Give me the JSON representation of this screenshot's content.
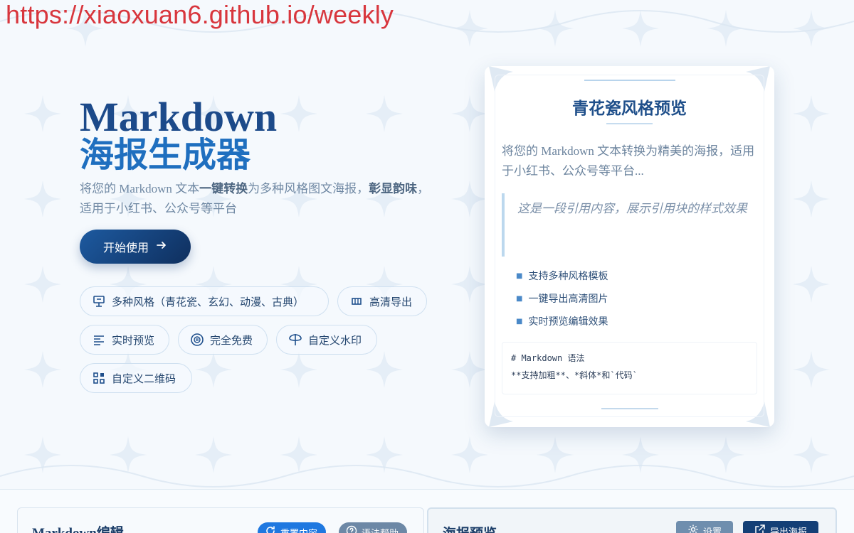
{
  "banner": {
    "url": "https://xiaoxuan6.github.io/weekly"
  },
  "hero": {
    "title_en": "Markdown",
    "title_cn": "海报生成器",
    "desc_part1": "将您的 Markdown 文本",
    "desc_bold1": "一键转换",
    "desc_part2": "为多种风格图文海报，",
    "desc_bold2": "彰显韵味",
    "desc_part3": "，",
    "desc_line2": "适用于小红书、公众号等平台",
    "start_button": "开始使用"
  },
  "features": [
    {
      "label": "多种风格（青花瓷、玄幻、动漫、古典）",
      "icon": "presentation-icon"
    },
    {
      "label": "高清导出",
      "icon": "film-icon"
    },
    {
      "label": "实时预览",
      "icon": "align-left-icon"
    },
    {
      "label": "完全免费",
      "icon": "coin-icon"
    },
    {
      "label": "自定义水印",
      "icon": "signpost-icon"
    },
    {
      "label": "自定义二维码",
      "icon": "qrcode-icon"
    }
  ],
  "preview_card": {
    "title": "青花瓷风格预览",
    "paragraph": "将您的 Markdown 文本转换为精美的海报，适用于小红书、公众号等平台...",
    "quote": "这是一段引用内容，展示引用块的样式效果",
    "list": [
      "支持多种风格模板",
      "一键导出高清图片",
      "实时预览编辑效果"
    ],
    "code_line1": "# Markdown 语法",
    "code_line2": "**支持加粗**、*斜体*和`代码`"
  },
  "editor_panel": {
    "title": "Markdown编辑",
    "reset_button": "重置内容",
    "help_button": "语法帮助"
  },
  "poster_panel": {
    "title": "海报预览",
    "settings_button": "设置",
    "export_button": "导出海报"
  },
  "colors": {
    "accent": "#1f6fbf",
    "brand_dark": "#1c4a8a",
    "banner_red": "#d8363d",
    "background": "#f5f9fd"
  }
}
